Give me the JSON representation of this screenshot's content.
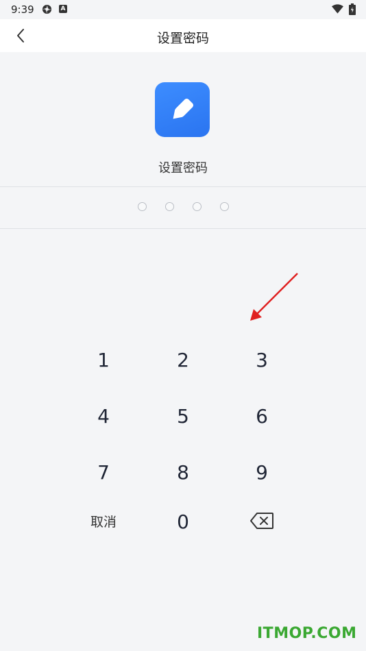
{
  "status_bar": {
    "time": "9:39",
    "notif_icon_a": "settings-wheel-icon",
    "notif_icon_b": "A",
    "wifi_icon": "wifi-icon",
    "battery_icon": "battery-icon"
  },
  "header": {
    "back_icon": "chevron-left-icon",
    "title": "设置密码"
  },
  "app_icon": {
    "name": "pencil-edit-icon",
    "color": "#3183f8"
  },
  "prompt": {
    "label": "设置密码"
  },
  "pin": {
    "length": 4,
    "entered": 0
  },
  "keypad": {
    "keys": [
      "1",
      "2",
      "3",
      "4",
      "5",
      "6",
      "7",
      "8",
      "9"
    ],
    "cancel_label": "取消",
    "zero_label": "0",
    "delete_icon": "backspace-icon"
  },
  "watermark": {
    "text": "ITMOP.COM",
    "color": "#3aa832"
  },
  "annotation": {
    "arrow_color": "#e02020"
  }
}
